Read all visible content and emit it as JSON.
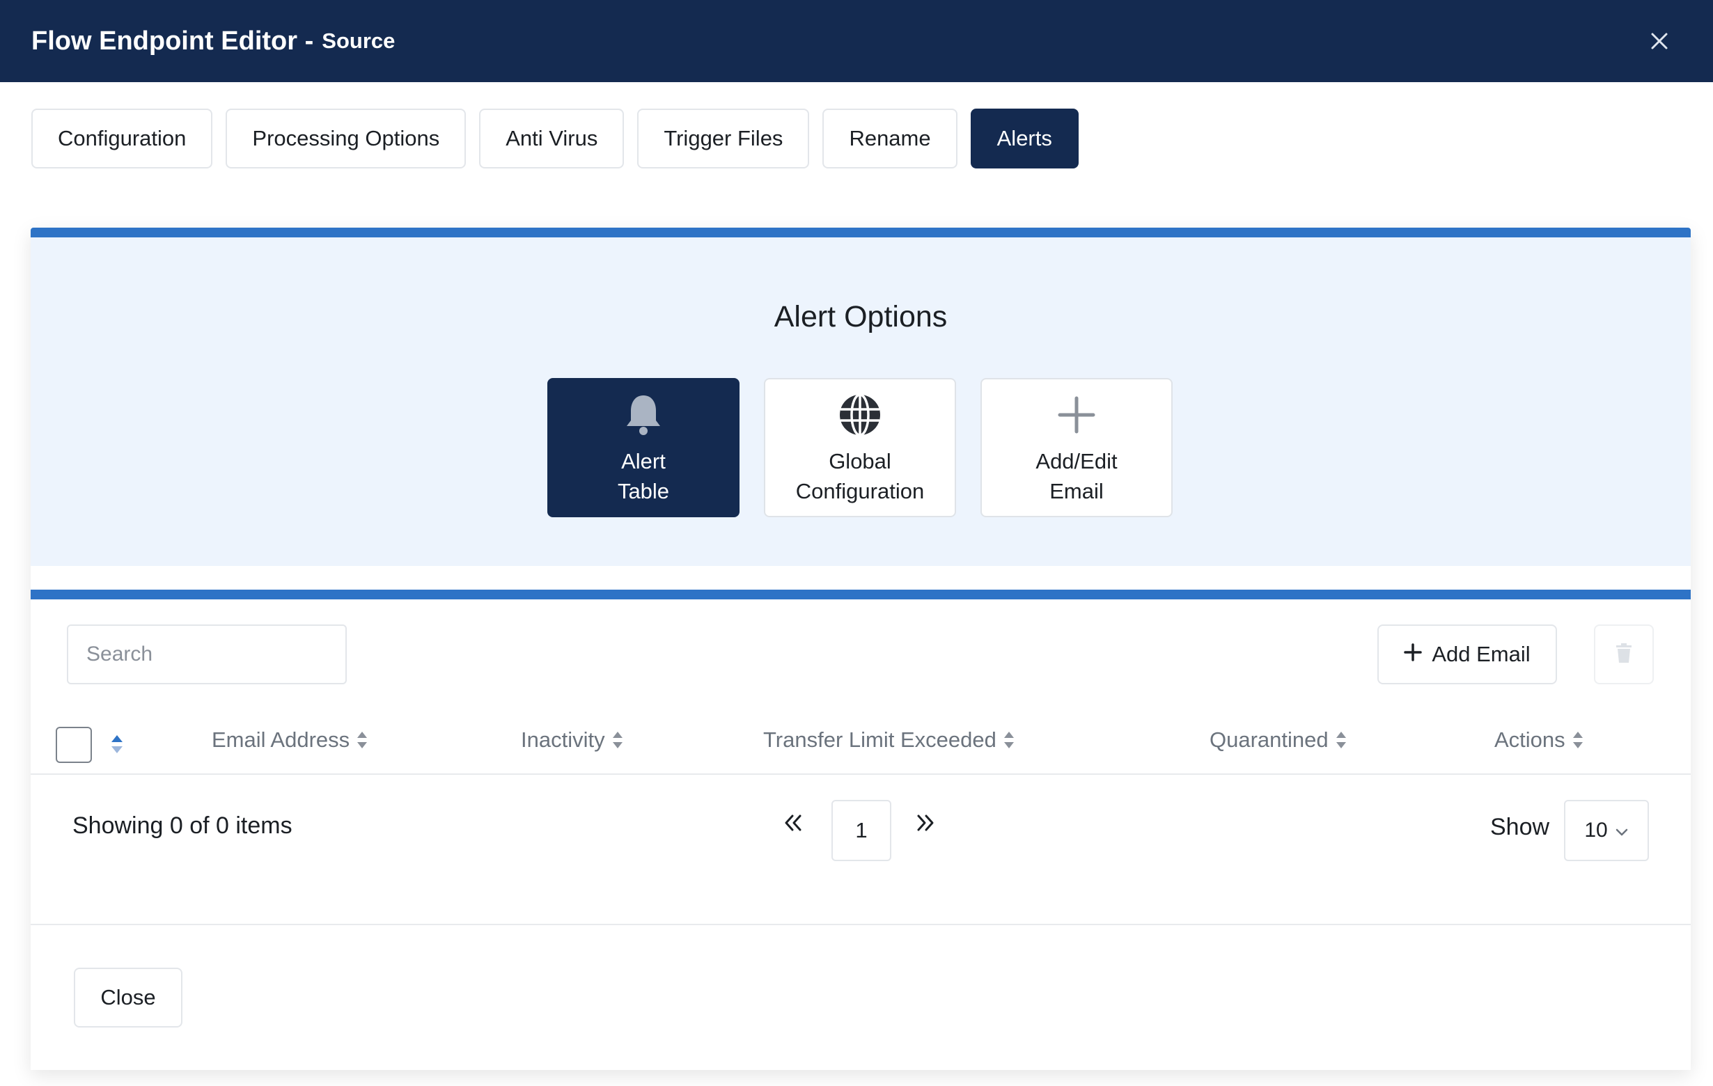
{
  "header": {
    "title": "Flow Endpoint Editor -",
    "subtitle": "Source",
    "close_icon": "close-icon"
  },
  "tabs": [
    {
      "label": "Configuration",
      "active": false
    },
    {
      "label": "Processing Options",
      "active": false
    },
    {
      "label": "Anti Virus",
      "active": false
    },
    {
      "label": "Trigger Files",
      "active": false
    },
    {
      "label": "Rename",
      "active": false
    },
    {
      "label": "Alerts",
      "active": true
    }
  ],
  "alert_options": {
    "title": "Alert Options",
    "cards": [
      {
        "line1": "Alert",
        "line2": "Table",
        "icon": "bell-icon",
        "active": true
      },
      {
        "line1": "Global",
        "line2": "Configuration",
        "icon": "globe-icon",
        "active": false
      },
      {
        "line1": "Add/Edit",
        "line2": "Email",
        "icon": "plus-icon",
        "active": false
      }
    ]
  },
  "table": {
    "search_placeholder": "Search",
    "add_email_label": "Add Email",
    "columns": [
      "Email Address",
      "Inactivity",
      "Transfer Limit Exceeded",
      "Quarantined",
      "Actions"
    ],
    "rows": [],
    "showing_text": "Showing 0 of 0 items",
    "current_page": "1",
    "show_label": "Show",
    "page_size": "10"
  },
  "footer": {
    "close_label": "Close"
  },
  "colors": {
    "header_bg": "#142a50",
    "accent_blue": "#2e73c6",
    "options_bg": "#edf4fd",
    "active_tab_bg": "#142a50"
  }
}
